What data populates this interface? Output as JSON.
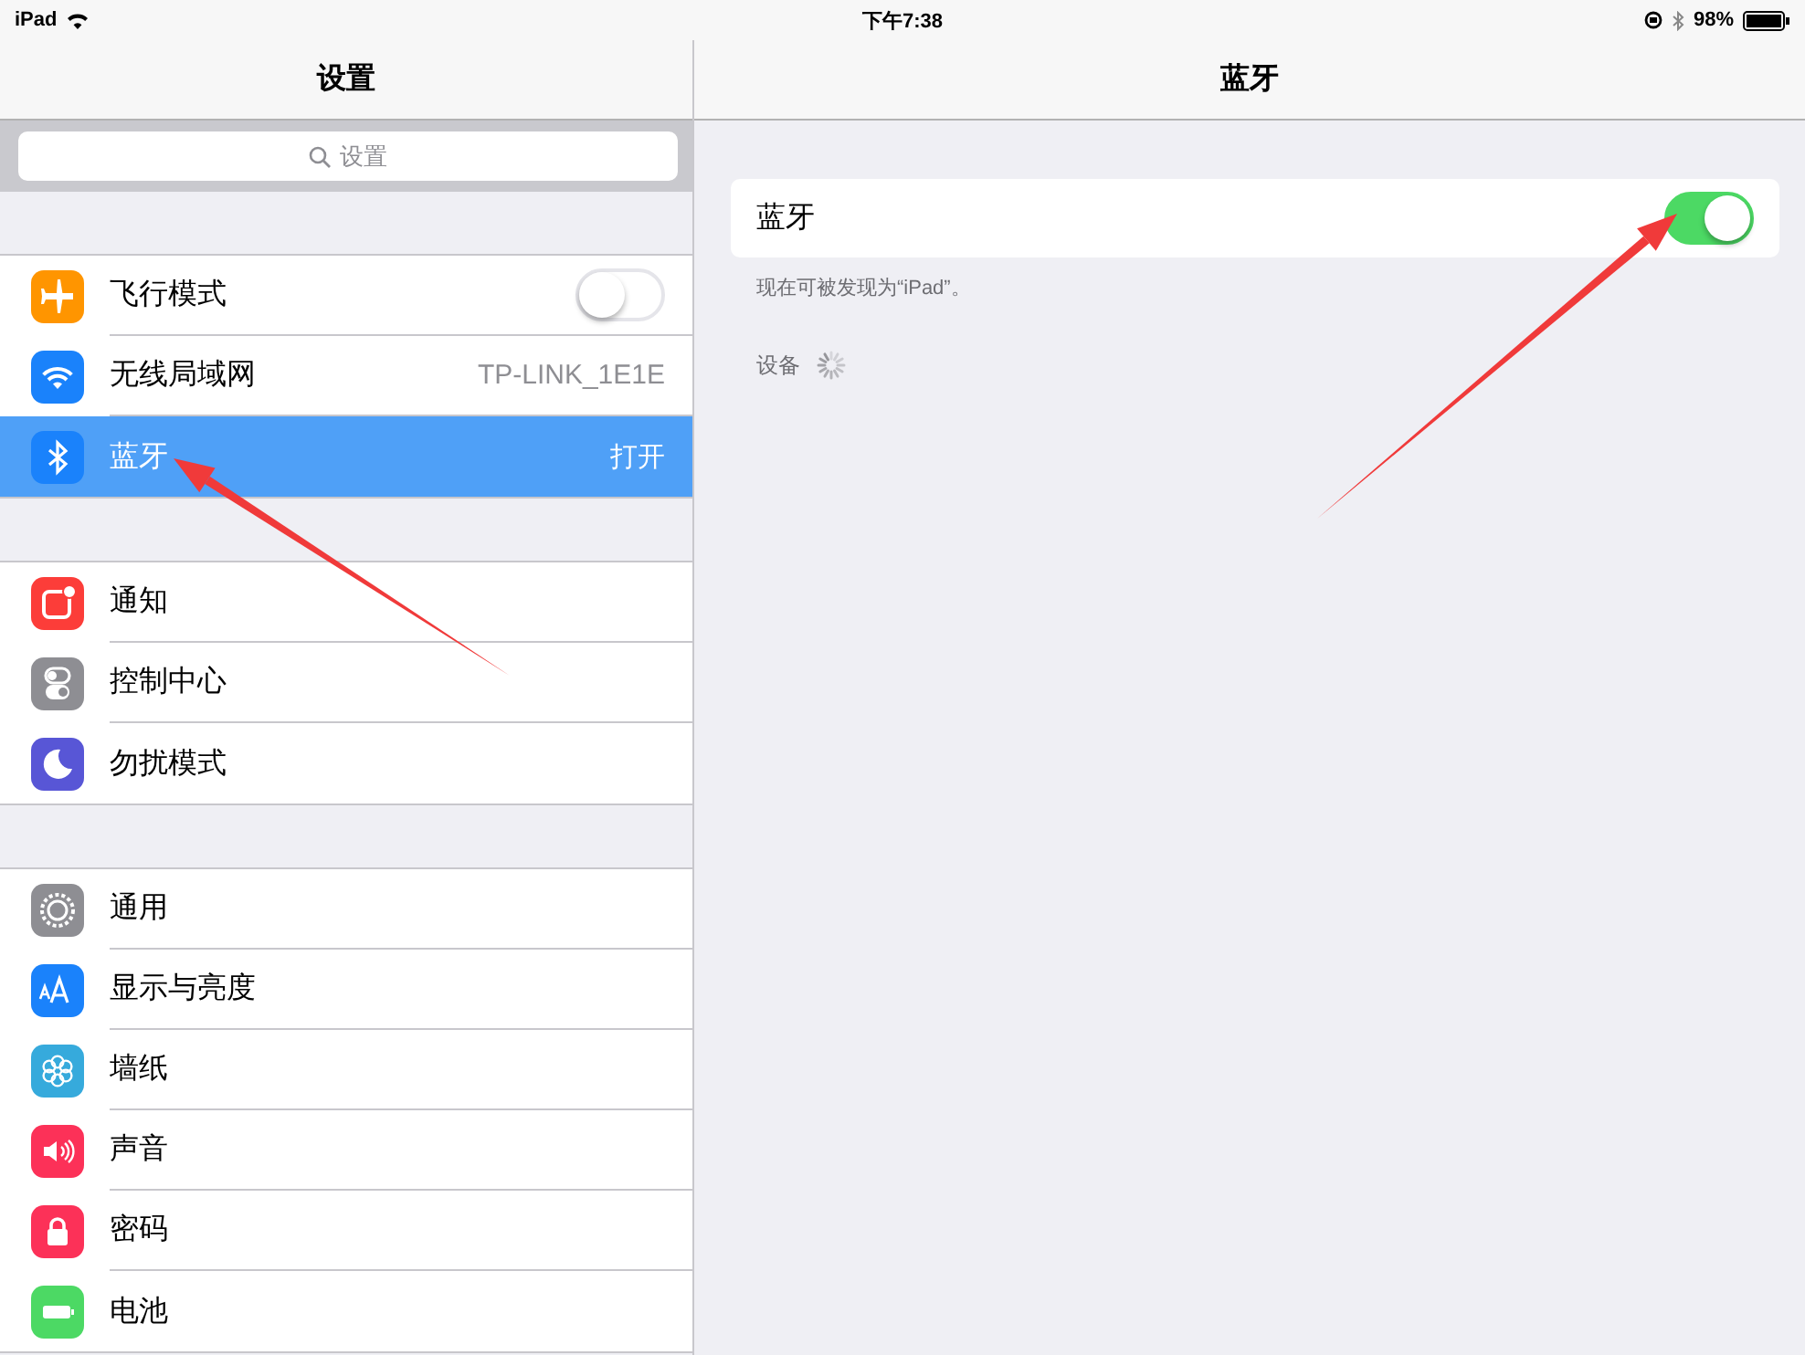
{
  "status_bar": {
    "device": "iPad",
    "time": "下午7:38",
    "battery": "98%"
  },
  "sidebar": {
    "title": "设置",
    "search": {
      "placeholder": "设置"
    },
    "groups": [
      {
        "items": [
          {
            "kind": "toggle",
            "label": "飞行模式",
            "color": "#ff9500",
            "on": false,
            "selected": false
          },
          {
            "kind": "value",
            "label": "无线局域网",
            "color": "#1a82fb",
            "value": "TP-LINK_1E1E",
            "selected": false
          },
          {
            "kind": "value",
            "label": "蓝牙",
            "color": "#1a82fb",
            "value": "打开",
            "selected": true
          }
        ]
      },
      {
        "items": [
          {
            "kind": "plain",
            "label": "通知",
            "color": "#fc3d39",
            "selected": false
          },
          {
            "kind": "plain",
            "label": "控制中心",
            "color": "#8e8e93",
            "selected": false
          },
          {
            "kind": "plain",
            "label": "勿扰模式",
            "color": "#5856d6",
            "selected": false
          }
        ]
      },
      {
        "items": [
          {
            "kind": "plain",
            "label": "通用",
            "color": "#8e8e93",
            "selected": false
          },
          {
            "kind": "plain",
            "label": "显示与亮度",
            "color": "#1a82fb",
            "selected": false
          },
          {
            "kind": "plain",
            "label": "墙纸",
            "color": "#36aadc",
            "selected": false
          },
          {
            "kind": "plain",
            "label": "声音",
            "color": "#fc3158",
            "selected": false
          },
          {
            "kind": "plain",
            "label": "密码",
            "color": "#fc3158",
            "selected": false
          },
          {
            "kind": "plain",
            "label": "电池",
            "color": "#4cd964",
            "selected": false
          }
        ]
      }
    ]
  },
  "detail": {
    "title": "蓝牙",
    "setting": {
      "label": "蓝牙",
      "on": true
    },
    "footer": "现在可被发现为“iPad”。",
    "section": "设备"
  }
}
